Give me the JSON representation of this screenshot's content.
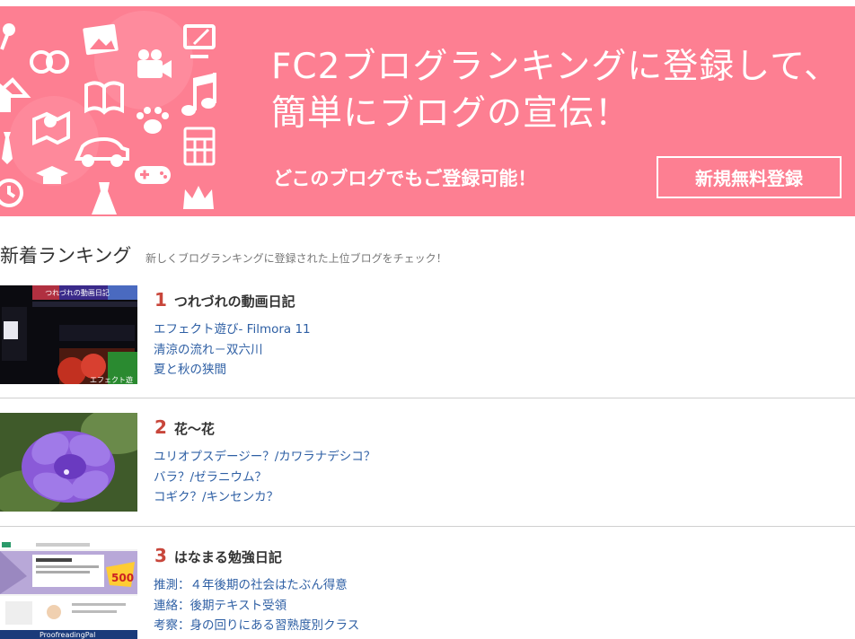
{
  "banner": {
    "title_line1": "FC2ブログランキングに登録して、",
    "title_line2": "簡単にブログの宣伝！",
    "subtitle": "どこのブログでもご登録可能！",
    "register_label": "新規無料登録",
    "bg_color": "#fd7f92",
    "icons": [
      "microphone-icon",
      "wedding-rings-icon",
      "photo-icon",
      "movie-camera-icon",
      "tv-icon",
      "house-icon",
      "book-icon",
      "music-note-icon",
      "map-icon",
      "paw-icon",
      "car-icon",
      "calculator-icon",
      "necktie-icon",
      "graduation-cap-icon",
      "dress-icon",
      "gamepad-icon",
      "clock-icon",
      "crown-icon"
    ]
  },
  "section": {
    "title": "新着ランキング",
    "description": "新しくブログランキングに登録された上位ブログをチェック！"
  },
  "rankings": [
    {
      "rank": "1",
      "name": "つれづれの動画日記",
      "entries": [
        "エフェクト遊び- Filmora 11",
        "清涼の流れ－双六川",
        "夏と秋の狭間"
      ],
      "thumb_text": [
        "つれづれの動画日記",
        "エフェクト遊"
      ]
    },
    {
      "rank": "2",
      "name": "花～花",
      "entries": [
        "ユリオプスデージー？/カワラナデシコ？",
        "バラ？/ゼラニウム？",
        "コギク？/キンセンカ？"
      ]
    },
    {
      "rank": "3",
      "name": "はなまる勉強日記",
      "entries": [
        "推測：４年後期の社会はたぶん得意",
        "連絡：後期テキスト受領",
        "考察：身の回りにある習熟度別クラス"
      ],
      "thumb_text": [
        "500",
        "ProofreadingPal"
      ]
    }
  ],
  "colors": {
    "rank_number": "#c8463b",
    "link": "#2e5fa4",
    "divider": "#cfcfcf"
  }
}
